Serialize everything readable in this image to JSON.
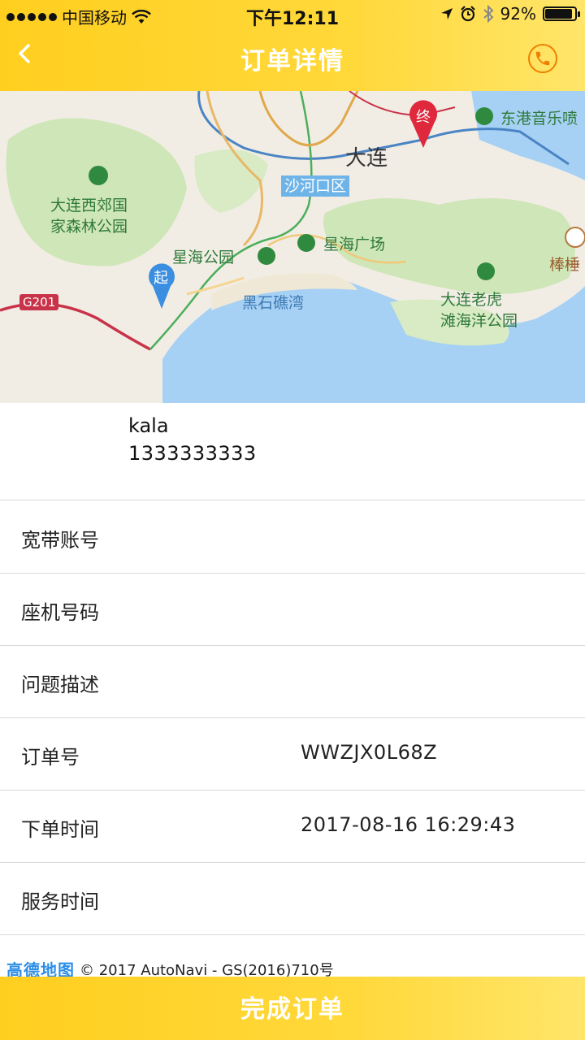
{
  "status_bar": {
    "carrier": "中国移动",
    "time": "下午12:11",
    "battery": "92%",
    "battery_level": 0.92
  },
  "nav": {
    "title": "订单详情",
    "back_icon": "chevron-left-icon",
    "phone_icon": "phone-icon"
  },
  "map": {
    "labels": {
      "city": "大连",
      "district": "沙河口区",
      "park_west": "大连西郊国\n家森林公园",
      "xinghai_park": "星海公园",
      "xinghai_square": "星海广场",
      "bay": "黑石礁湾",
      "laohutan": "大连老虎\n滩海洋公园",
      "donggang": "东港音乐喷",
      "bangchui": "棒棰",
      "road": "G201",
      "start": "起",
      "end": "终"
    }
  },
  "customer": {
    "name": "kala",
    "phone": "1333333333"
  },
  "rows": [
    {
      "label": "宽带账号",
      "value": ""
    },
    {
      "label": "座机号码",
      "value": ""
    },
    {
      "label": "问题描述",
      "value": ""
    },
    {
      "label": "订单号",
      "value": "WWZJX0L68Z"
    },
    {
      "label": "下单时间",
      "value": "2017-08-16 16:29:43"
    },
    {
      "label": "服务时间",
      "value": ""
    }
  ],
  "attribution": {
    "logo": "高德地图",
    "text": "© 2017 AutoNavi - GS(2016)710号"
  },
  "footer": {
    "complete_label": "完成订单"
  },
  "colors": {
    "brand_yellow": "#ffd32a",
    "phone_orange": "#ef7f00",
    "start_pin": "#3b8ee0",
    "end_pin": "#e0283c"
  }
}
